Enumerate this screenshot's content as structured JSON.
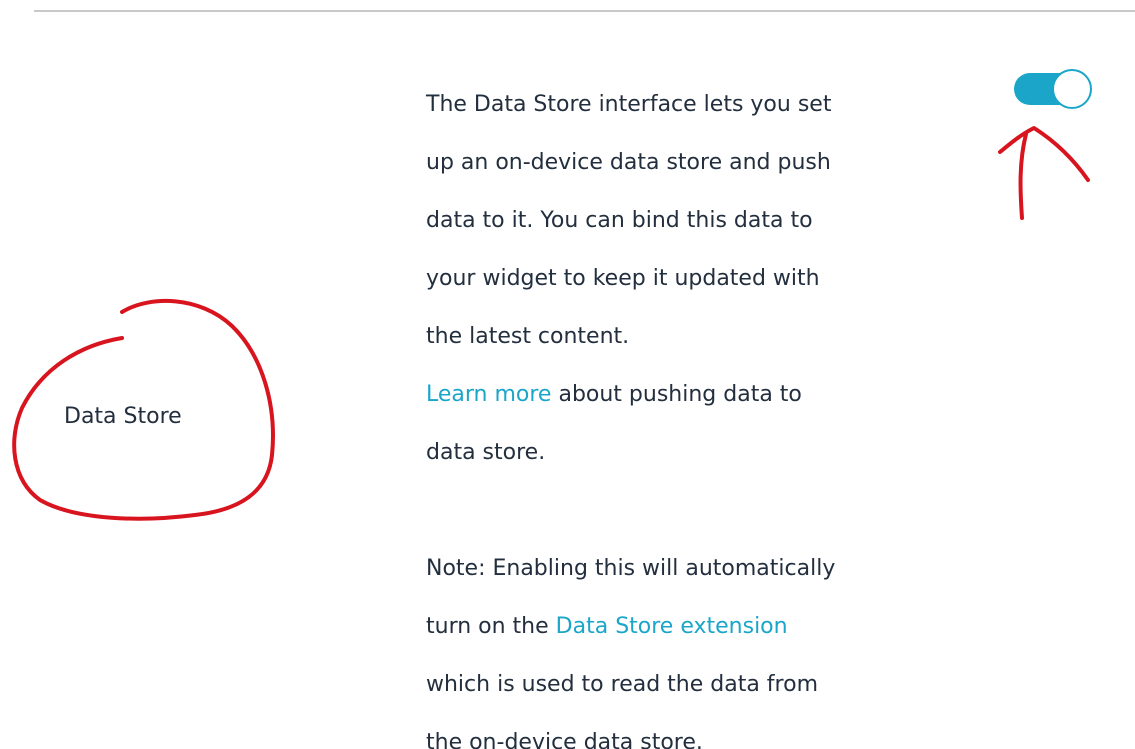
{
  "setting": {
    "label": "Data Store",
    "enabled": true
  },
  "description": {
    "line1": "The Data Store interface lets you set",
    "line2": "up an on-device data store and push",
    "line3": "data to it. You can bind this data to",
    "line4": "your widget to keep it updated with",
    "line5": "the latest content.",
    "learn_more_link": "Learn more",
    "learn_more_rest_1": " about pushing data to",
    "learn_more_rest_2": "data store."
  },
  "note": {
    "line1": "Note: Enabling this will automatically",
    "prefix": "turn on the ",
    "extension_link": "Data Store extension",
    "line3": "which is used to read the data from",
    "line4": "the on-device data store."
  },
  "colors": {
    "accent": "#1ba6c9",
    "text": "#232f3e",
    "annotation": "#d8141e"
  },
  "icons": {
    "annotation_circle": "hand-drawn-circle-icon",
    "annotation_arrow": "hand-drawn-arrow-icon"
  }
}
